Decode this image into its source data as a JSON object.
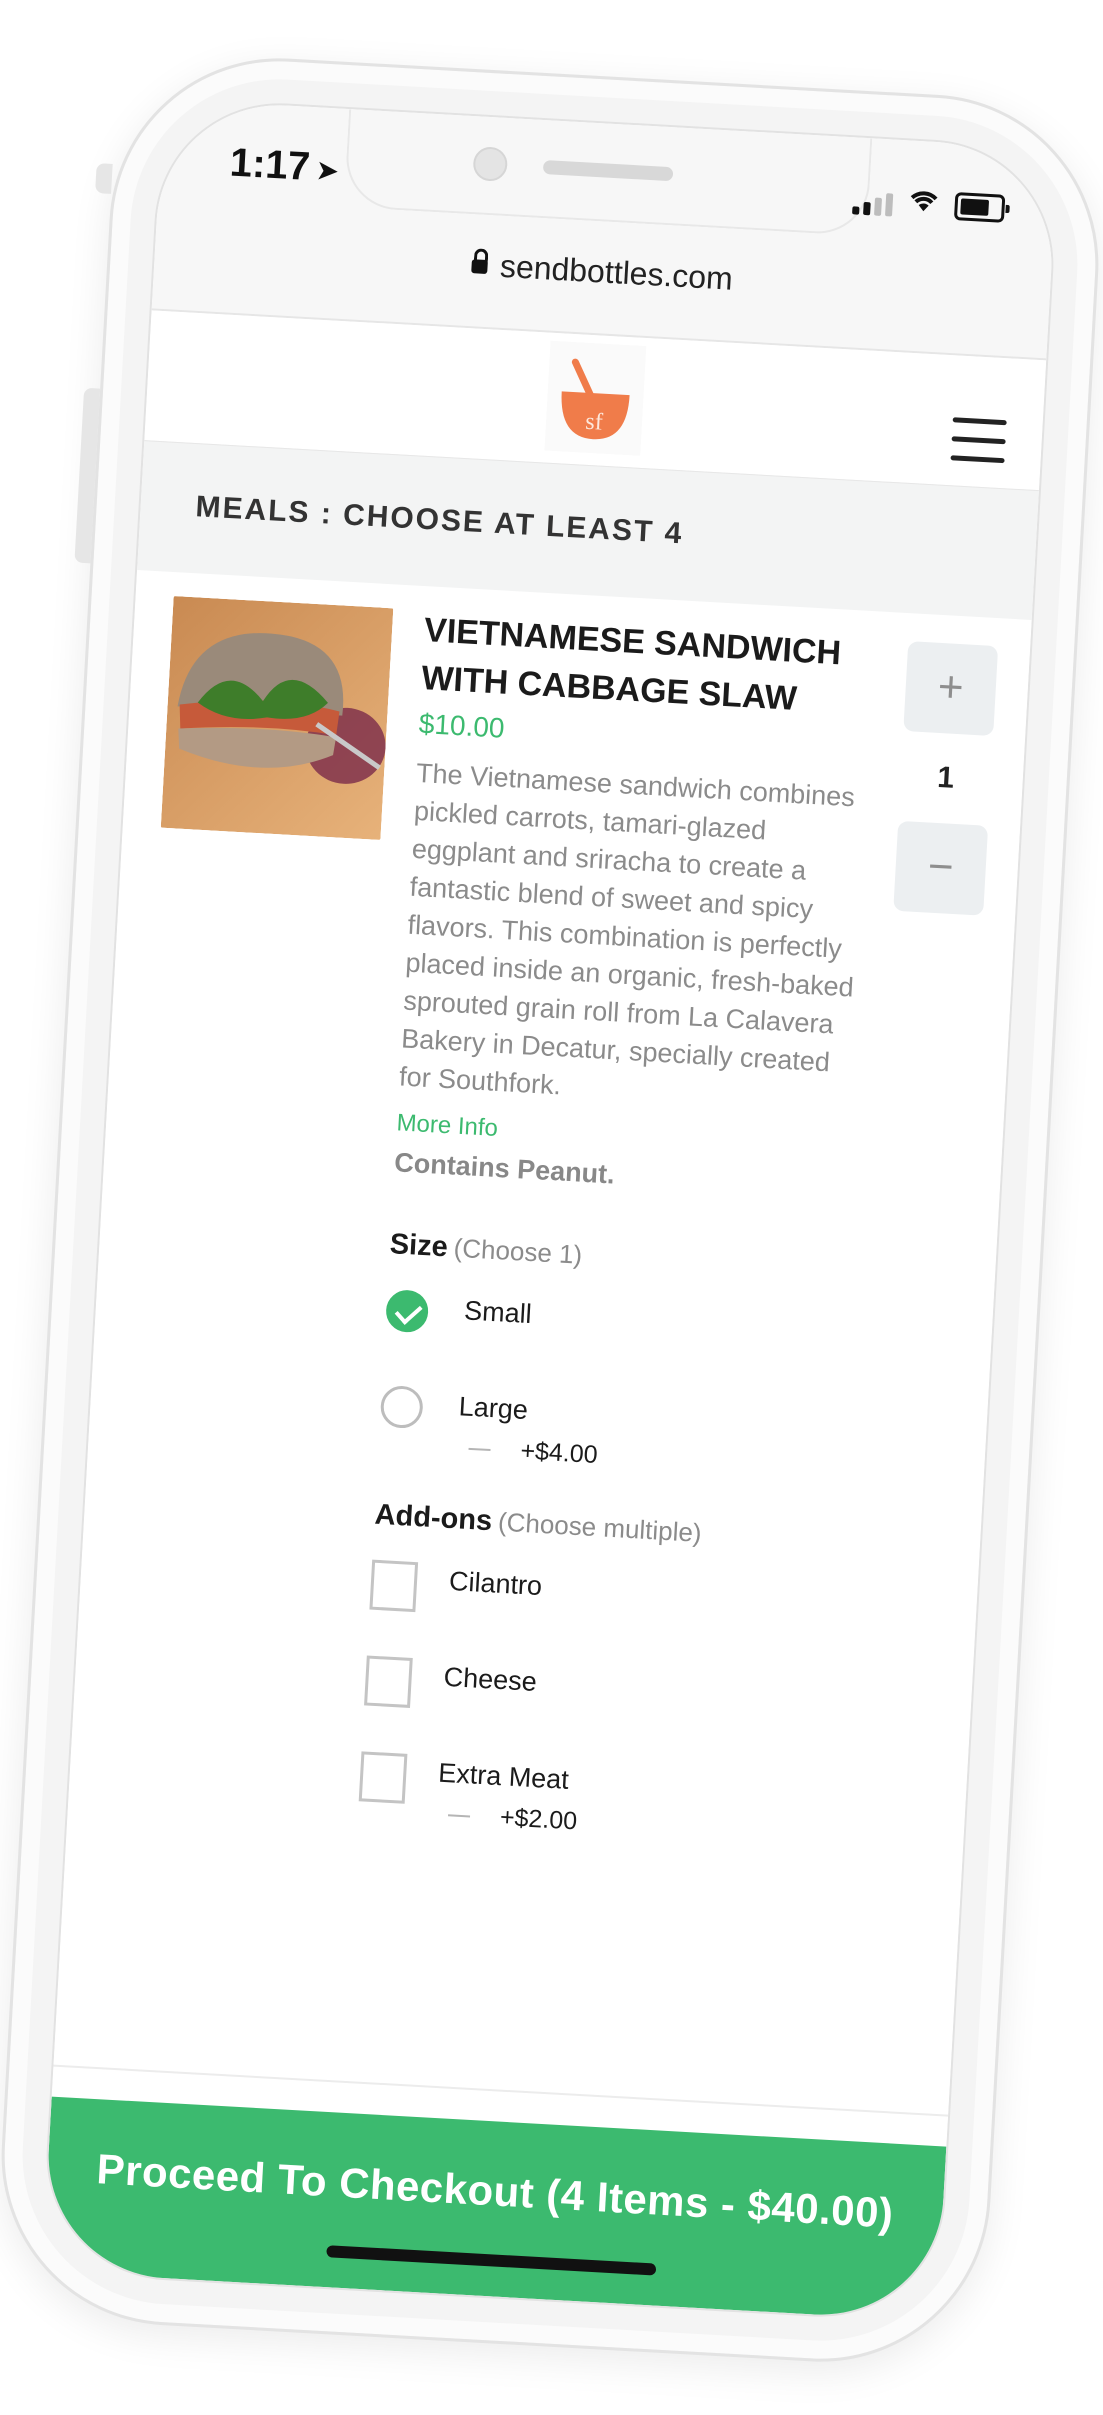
{
  "status_bar": {
    "time": "1:17",
    "location_icon": "location-arrow-icon",
    "signal_icon": "cellular-signal-icon",
    "wifi_icon": "wifi-icon",
    "battery_icon": "battery-icon"
  },
  "browser": {
    "url": "sendbottles.com",
    "lock_icon": "lock-icon"
  },
  "header": {
    "logo_text": "sf",
    "logo_icon": "bowl-spoon-logo",
    "menu_icon": "hamburger-menu-icon"
  },
  "section": {
    "title": "MEALS : CHOOSE AT LEAST 4"
  },
  "product": {
    "name": "VIETNAMESE SANDWICH WITH CABBAGE SLAW",
    "price": "$10.00",
    "description": "The Vietnamese sandwich combines pickled carrots, tamari-glazed eggplant and sriracha to create a fantastic blend of sweet and spicy flavors. This combination is perfectly placed inside an organic, fresh-baked sprouted grain roll from La Calavera Bakery in Decatur, specially created for Southfork.",
    "more_info": "More Info",
    "allergen": "Contains Peanut.",
    "quantity": "1",
    "increment_label": "+",
    "decrement_label": "−"
  },
  "size": {
    "label": "Size",
    "hint": "(Choose 1)",
    "options": [
      {
        "label": "Small",
        "selected": true,
        "extra": ""
      },
      {
        "label": "Large",
        "selected": false,
        "extra": "+$4.00"
      }
    ]
  },
  "addons": {
    "label": "Add-ons",
    "hint": "(Choose multiple)",
    "options": [
      {
        "label": "Cilantro",
        "checked": false,
        "extra": ""
      },
      {
        "label": "Cheese",
        "checked": false,
        "extra": ""
      },
      {
        "label": "Extra Meat",
        "checked": false,
        "extra": "+$2.00"
      }
    ]
  },
  "checkout": {
    "label": "Proceed To Checkout (4 Items - $40.00)"
  },
  "colors": {
    "accent": "#3cba6f",
    "logo_orange": "#f07c4a",
    "section_bg": "#f3f4f4",
    "stepper_bg": "#eceff1"
  }
}
